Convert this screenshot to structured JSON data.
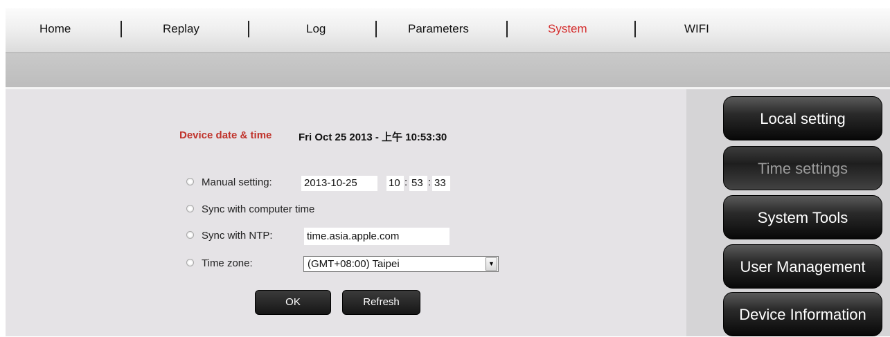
{
  "nav": {
    "items": [
      {
        "label": "Home"
      },
      {
        "label": "Replay"
      },
      {
        "label": "Log"
      },
      {
        "label": "Parameters"
      },
      {
        "label": "System"
      },
      {
        "label": "WIFI"
      }
    ],
    "active": "System",
    "active_color": "#d42b2b"
  },
  "device_time": {
    "label": "Device date & time",
    "value": "Fri Oct 25 2013 - 上午 10:53:30",
    "label_color": "#c0332b"
  },
  "time_form": {
    "manual": {
      "label": "Manual setting:",
      "date": "2013-10-25",
      "hour": "10",
      "minute": "53",
      "second": "33"
    },
    "sync_computer": {
      "label": "Sync with computer time"
    },
    "ntp": {
      "label": "Sync with NTP:",
      "server": "time.asia.apple.com"
    },
    "timezone": {
      "label": "Time zone:",
      "selected": "(GMT+08:00) Taipei"
    },
    "ok_label": "OK",
    "refresh_label": "Refresh"
  },
  "sidebar": {
    "items": [
      {
        "label": "Local setting"
      },
      {
        "label": "Time settings"
      },
      {
        "label": "System Tools"
      },
      {
        "label": "User Management"
      },
      {
        "label": "Device Information"
      }
    ],
    "active": "Time settings"
  }
}
